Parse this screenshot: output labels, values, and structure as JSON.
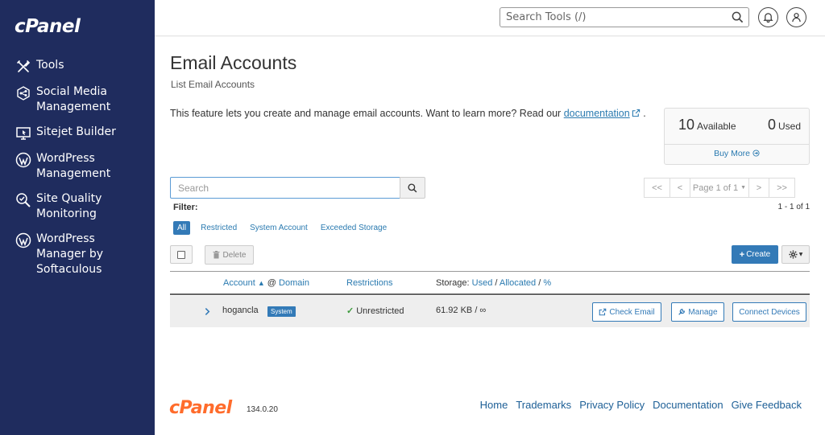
{
  "sidebar": {
    "logo": "cPanel",
    "items": [
      {
        "label": "Tools",
        "icon": "tools-icon"
      },
      {
        "label": "Social Media Management",
        "icon": "social-media-icon"
      },
      {
        "label": "Sitejet Builder",
        "icon": "sitejet-icon"
      },
      {
        "label": "WordPress Management",
        "icon": "wordpress-icon"
      },
      {
        "label": "Site Quality Monitoring",
        "icon": "site-quality-icon"
      },
      {
        "label": "WordPress Manager by Softaculous",
        "icon": "wordpress-icon"
      }
    ]
  },
  "header": {
    "search_placeholder": "Search Tools (/)"
  },
  "page": {
    "title": "Email Accounts",
    "subtitle": "List Email Accounts",
    "description": "This feature lets you create and manage email accounts. Want to learn more? Read our",
    "doc_link": "documentation",
    "desc_end": "."
  },
  "stats": {
    "available_num": "10",
    "available_label": "Available",
    "used_num": "0",
    "used_label": "Used",
    "buy_more": "Buy More"
  },
  "search": {
    "placeholder": "Search"
  },
  "pagination": {
    "first": "<<",
    "prev": "<",
    "page": "Page 1 of 1",
    "next": ">",
    "last": ">>",
    "count": "1 - 1 of 1"
  },
  "filter": {
    "label": "Filter:",
    "options": [
      "All",
      "Restricted",
      "System Account",
      "Exceeded Storage"
    ]
  },
  "actions": {
    "delete": "Delete",
    "create": "Create"
  },
  "table": {
    "headers": {
      "account": "Account",
      "at": "@",
      "domain": "Domain",
      "restrictions": "Restrictions",
      "storage_prefix": "Storage:",
      "used": "Used",
      "allocated": "Allocated",
      "percent": "%"
    },
    "rows": [
      {
        "account": "hogancla",
        "badge": "System",
        "restriction": "Unrestricted",
        "storage": "61.92 KB / ∞",
        "check_email": "Check Email",
        "manage": "Manage",
        "connect": "Connect Devices"
      }
    ]
  },
  "footer": {
    "logo": "cPanel",
    "version": "134.0.20",
    "links": [
      "Home",
      "Trademarks",
      "Privacy Policy",
      "Documentation",
      "Give Feedback"
    ]
  },
  "colors": {
    "sidebar_bg": "#1f2c5e",
    "accent": "#337ab7",
    "brand_orange": "#ff6c2c"
  }
}
